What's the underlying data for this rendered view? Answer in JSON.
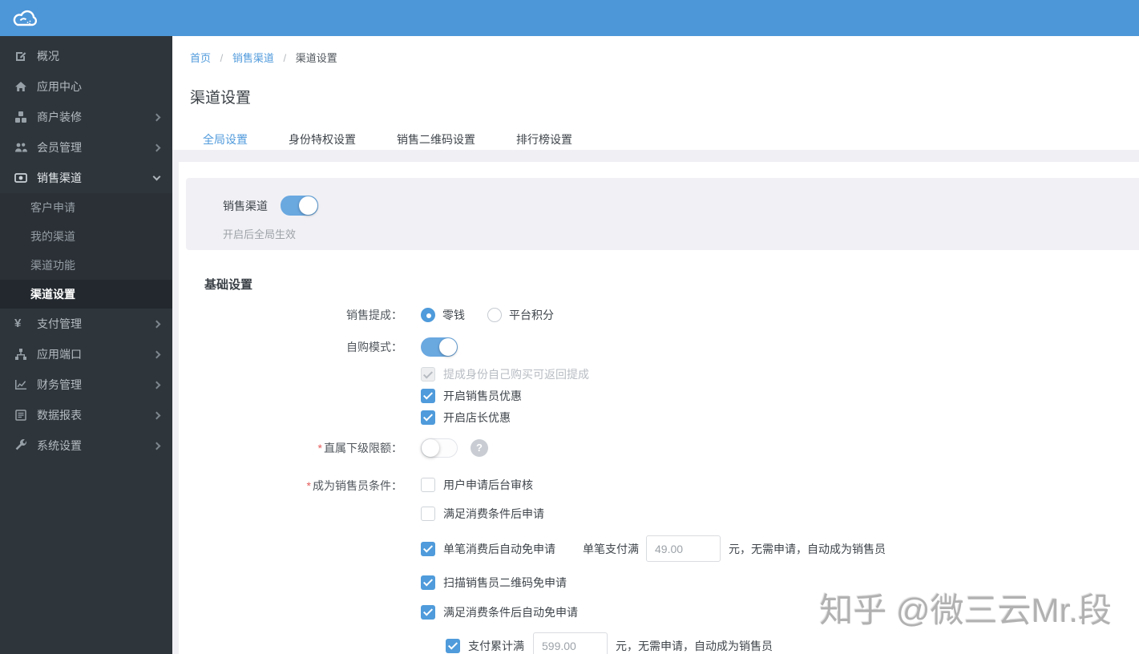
{
  "colors": {
    "header_blue": "#4d96d8",
    "sidebar_dark": "#2e353b",
    "accent_blue": "#4f9bdb",
    "link_blue": "#519bdc",
    "panel_gray": "#f1f1f5",
    "required_red": "#e65a5a"
  },
  "sidebar": {
    "items": [
      {
        "label": "概况",
        "icon": "edit-icon"
      },
      {
        "label": "应用中心",
        "icon": "home-icon"
      },
      {
        "label": "商户装修",
        "icon": "boxes-icon",
        "chevron": "right"
      },
      {
        "label": "会员管理",
        "icon": "users-icon",
        "chevron": "right"
      },
      {
        "label": "销售渠道",
        "icon": "money-icon",
        "chevron": "down",
        "expanded": true,
        "children": [
          {
            "label": "客户申请",
            "active": false
          },
          {
            "label": "我的渠道",
            "active": false
          },
          {
            "label": "渠道功能",
            "active": false
          },
          {
            "label": "渠道设置",
            "active": true
          }
        ]
      },
      {
        "label": "支付管理",
        "icon": "yen-icon",
        "chevron": "right"
      },
      {
        "label": "应用端口",
        "icon": "port-icon",
        "chevron": "right"
      },
      {
        "label": "财务管理",
        "icon": "chart-icon",
        "chevron": "right"
      },
      {
        "label": "数据报表",
        "icon": "report-icon",
        "chevron": "right"
      },
      {
        "label": "系统设置",
        "icon": "wrench-icon",
        "chevron": "right"
      }
    ]
  },
  "breadcrumb": {
    "home": "首页",
    "section": "销售渠道",
    "current": "渠道设置",
    "separator": "/"
  },
  "page": {
    "title": "渠道设置"
  },
  "tabs": {
    "items": [
      {
        "label": "全局设置",
        "active": true
      },
      {
        "label": "身份特权设置",
        "active": false
      },
      {
        "label": "销售二维码设置",
        "active": false
      },
      {
        "label": "排行榜设置",
        "active": false
      }
    ]
  },
  "channel_panel": {
    "label": "销售渠道",
    "toggle_on": true,
    "helper": "开启后全局生效"
  },
  "basic_section": {
    "title": "基础设置"
  },
  "form": {
    "commission": {
      "label": "销售提成：",
      "options": [
        {
          "label": "零钱",
          "selected": true
        },
        {
          "label": "平台积分",
          "selected": false
        }
      ]
    },
    "self_purchase": {
      "label": "自购模式：",
      "toggle_on": true,
      "checkboxes": [
        {
          "label": "提成身份自己购买可返回提成",
          "checked": true,
          "disabled": true
        },
        {
          "label": "开启销售员优惠",
          "checked": true,
          "disabled": false
        },
        {
          "label": "开启店长优惠",
          "checked": true,
          "disabled": false
        }
      ]
    },
    "subordinate_limit": {
      "required": "*",
      "label": "直属下级限额：",
      "toggle_on": false,
      "help_icon": "?"
    },
    "become_salesman": {
      "required": "*",
      "label": "成为销售员条件：",
      "conditions": [
        {
          "label": "用户申请后台审核",
          "checked": false
        },
        {
          "label": "满足消费条件后申请",
          "checked": false
        },
        {
          "label": "单笔消费后自动免申请",
          "checked": true,
          "extra": {
            "prefix": "单笔支付满",
            "value": "49.00",
            "suffix": "元，无需申请，自动成为销售员"
          }
        },
        {
          "label": "扫描销售员二维码免申请",
          "checked": true
        },
        {
          "label": "满足消费条件后自动免申请",
          "checked": true,
          "child": {
            "checked": true,
            "prefix": "支付累计满",
            "value": "599.00",
            "suffix": "元，无需申请，自动成为销售员"
          }
        }
      ]
    }
  },
  "watermark": "知乎 @微三云Mr.段"
}
